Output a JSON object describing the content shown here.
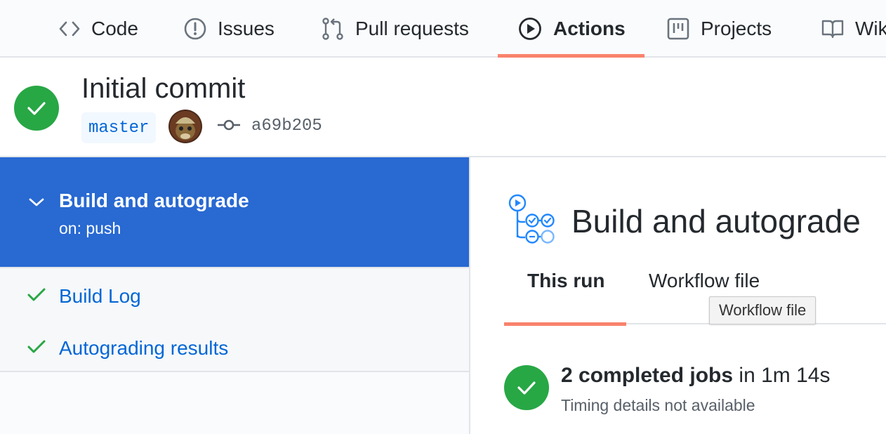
{
  "nav": {
    "tabs": [
      {
        "label": "Code",
        "icon": "code-icon"
      },
      {
        "label": "Issues",
        "icon": "issue-icon"
      },
      {
        "label": "Pull requests",
        "icon": "pull-request-icon"
      },
      {
        "label": "Actions",
        "icon": "play-icon",
        "selected": true
      },
      {
        "label": "Projects",
        "icon": "project-icon"
      },
      {
        "label": "Wiki",
        "icon": "book-icon"
      }
    ]
  },
  "header": {
    "commit_title": "Initial commit",
    "branch": "master",
    "commit_sha": "a69b205",
    "status": "success"
  },
  "sidebar": {
    "workflow": {
      "name": "Build and autograde",
      "trigger": "on: push"
    },
    "jobs": [
      {
        "label": "Build Log",
        "status": "success"
      },
      {
        "label": "Autograding results",
        "status": "success"
      }
    ]
  },
  "main": {
    "title": "Build and autograde",
    "tabs": [
      "This run",
      "Workflow file"
    ],
    "tooltip": "Workflow file",
    "summary": {
      "count_text": "2 completed jobs",
      "duration_text": "in 1m 14s"
    },
    "timing": "Timing details not available"
  },
  "colors": {
    "success": "#28a745",
    "accent": "#f9826c",
    "selected_bg": "#2869d2",
    "link": "#0366d6"
  }
}
